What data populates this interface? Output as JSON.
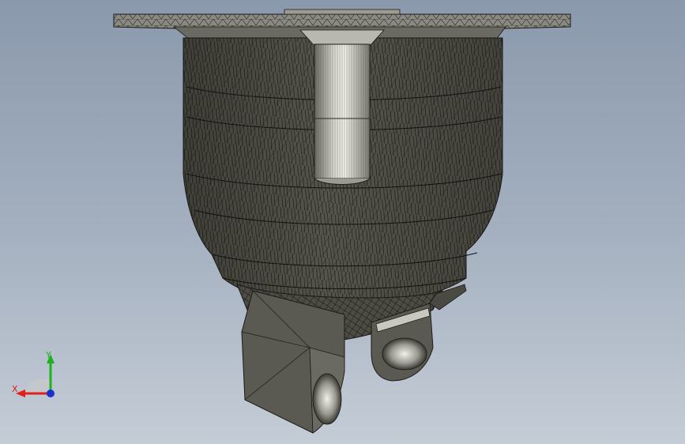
{
  "viewport": {
    "background_top": "#8a99ac",
    "background_bottom": "#c4ccd6"
  },
  "model": {
    "description_icon": "cad-mesh-model",
    "body_color": "#53534a",
    "edge_color": "#1a1a16",
    "flange_color": "#6e6e66",
    "bore_highlight": "#e8e8e0"
  },
  "triad": {
    "x_label": "X",
    "y_label": "Y",
    "x_color": "#e0201a",
    "y_color": "#1fb21f",
    "z_color": "#1a2fd0"
  }
}
